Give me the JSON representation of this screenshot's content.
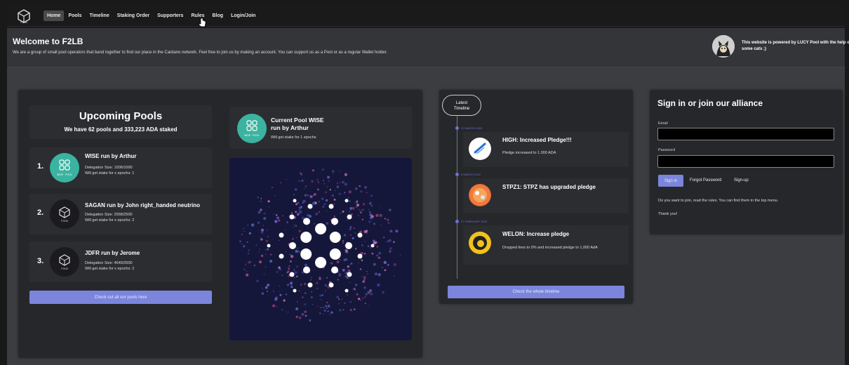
{
  "nav": {
    "items": [
      {
        "label": "Home",
        "active": true
      },
      {
        "label": "Pools"
      },
      {
        "label": "Timeline"
      },
      {
        "label": "Staking Order"
      },
      {
        "label": "Supporters"
      },
      {
        "label": "Rules"
      },
      {
        "label": "Blog"
      },
      {
        "label": "Login/Join"
      }
    ]
  },
  "hero": {
    "title": "Welcome to F2LB",
    "subtitle": "We are a group of small pool operators that band together to find our place in the Cardano network. Feel free to join us by making an account. You can support us as a Pool or as a regular Wallet holder.",
    "powered": "This website is powered by LUCY Pool with the help of some cats ;)"
  },
  "upcoming": {
    "title": "Upcoming Pools",
    "subtitle": "We have 62 pools and 333,223 ADA staked",
    "pools": [
      {
        "num": "1.",
        "name": "WISE run by Arthur",
        "size": "Delegation Size: 1006/1000",
        "epochs": "Will get stake for x epochs: 1",
        "avatar_label": "WISE · POOL",
        "avatar_color": "#3bb3a0"
      },
      {
        "num": "2.",
        "name": "SAGAN run by John right_handed neutrino",
        "size": "Delegation Size: 2568/2500",
        "epochs": "Will get stake for x epochs: 2",
        "avatar_label": "F2LB",
        "avatar_color": "#1b1b1f"
      },
      {
        "num": "3.",
        "name": "JDFR run by Jerome",
        "size": "Delegation Size: 4649/2500",
        "epochs": "Will get stake for x epochs: 2",
        "avatar_label": "F2LB",
        "avatar_color": "#1b1b1f"
      }
    ],
    "button": "Check out all our pools here"
  },
  "current": {
    "title_line1": "Current Pool WISE",
    "title_line2": "run by Arthur",
    "sub": "Will get stake for 1 epochs",
    "avatar_label": "WISE · POOL"
  },
  "timeline": {
    "badge_line1": "Latest",
    "badge_line2": "Timeline",
    "items": [
      {
        "date": "17 MARCH 2022",
        "title": "HIGH: Increased Pledge!!!",
        "text": "Pledge increased to 1.000 ADA"
      },
      {
        "date": "6 MARCH 2022",
        "title": "STPZ1: STPZ has upgraded pledge",
        "text": ""
      },
      {
        "date": "27 FEBRUARY 2022",
        "title": "WELON: Increase pledge",
        "text": "Dropped fees to 0% and increased pledge to 1,000 AdA"
      }
    ],
    "button": "Check the whole timeline"
  },
  "signin": {
    "title": "Sign in or join our alliance",
    "email_label": "Email",
    "password_label": "Password",
    "signin_button": "Sign in",
    "forgot": "Forgot Password",
    "signup": "Sign-up",
    "note": "Do you want to join, read the rules. You can find them in the top menu.",
    "thanks": "Thank you!"
  },
  "colors": {
    "accent": "#7b85dc",
    "wise_teal": "#3bb3a0",
    "timeline_dot": "#6b72d6"
  }
}
